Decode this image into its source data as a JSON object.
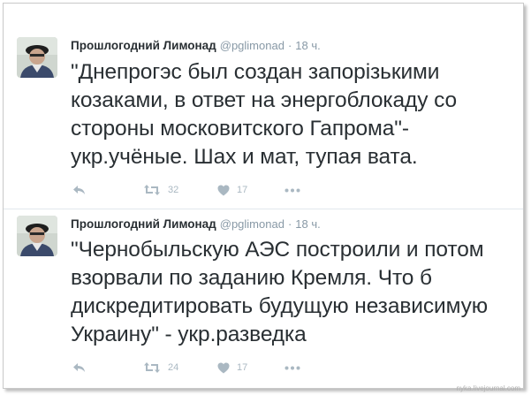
{
  "tweets": [
    {
      "author_name": "Прошлогодний Лимонад",
      "handle": "@pglimonad",
      "separator": "·",
      "time": "18 ч.",
      "text": "\"Днепрогэс был создан запорізькими козаками, в ответ на энергоблокаду со стороны московитского Гапрома\"- укр.учёные. Шах и мат, тупая вата.",
      "retweets": "32",
      "likes": "17"
    },
    {
      "author_name": "Прошлогодний Лимонад",
      "handle": "@pglimonad",
      "separator": "·",
      "time": "18 ч.",
      "text": "\"Чернобыльскую АЭС построили и потом взорвали по заданию Кремля. Что б дискредитировать будущую независимую Украину\" - укр.разведка",
      "retweets": "24",
      "likes": "17"
    }
  ],
  "watermark": "nyka.livejournal.com",
  "icons": {
    "reply": "reply-icon",
    "retweet": "retweet-icon",
    "like": "heart-icon",
    "more": "more-icon"
  },
  "colors": {
    "text": "#292f33",
    "muted": "#8899a6",
    "icon": "#aab8c2"
  }
}
